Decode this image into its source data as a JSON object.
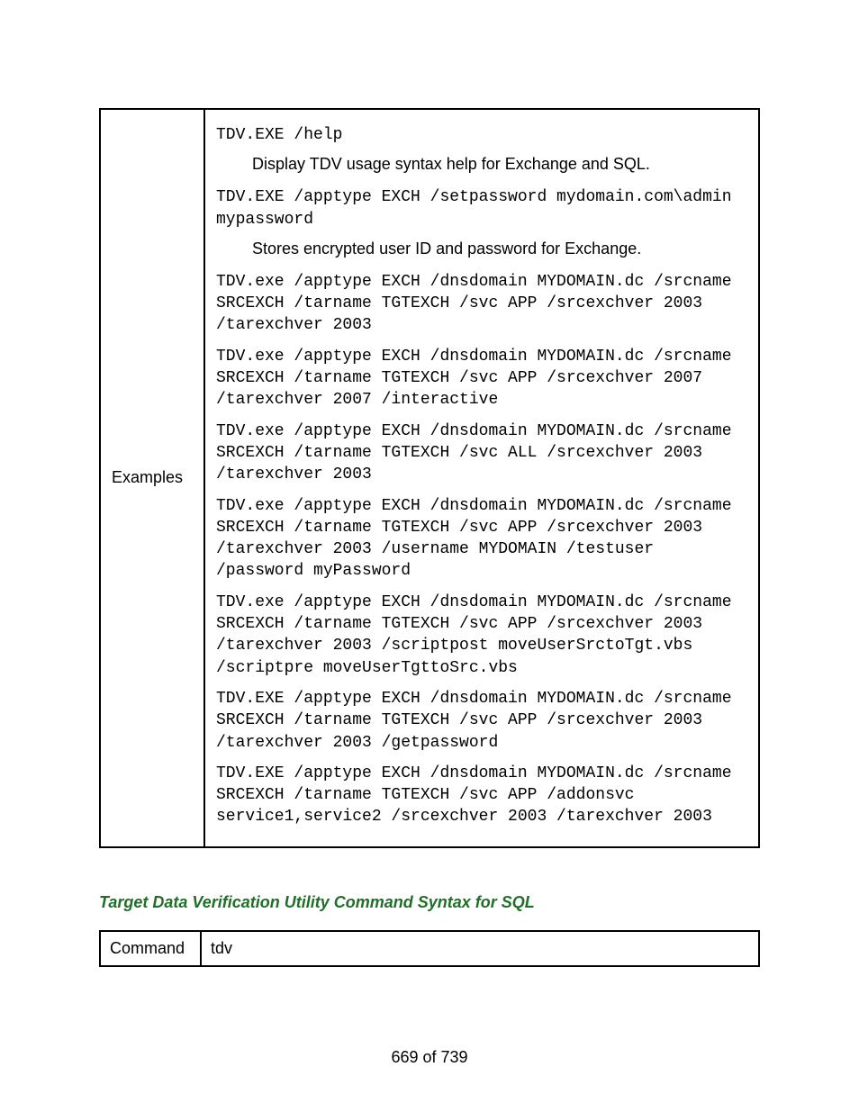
{
  "examples_label": "Examples",
  "blocks": [
    {
      "type": "mono",
      "text": "TDV.EXE /help"
    },
    {
      "type": "desc",
      "text": "Display TDV usage syntax help for Exchange and SQL."
    },
    {
      "type": "mono",
      "text": "TDV.EXE /apptype EXCH /setpassword mydomain.com\\admin mypassword"
    },
    {
      "type": "desc",
      "text": "Stores encrypted user ID and password for Exchange."
    },
    {
      "type": "mono",
      "text": "TDV.exe /apptype EXCH /dnsdomain MYDOMAIN.dc /srcname SRCEXCH /tarname TGTEXCH /svc APP /srcexchver 2003 /tarexchver 2003"
    },
    {
      "type": "mono",
      "text": "TDV.exe /apptype EXCH /dnsdomain MYDOMAIN.dc /srcname SRCEXCH /tarname TGTEXCH /svc APP /srcexchver 2007 /tarexchver 2007 /interactive"
    },
    {
      "type": "mono",
      "text": "TDV.exe /apptype EXCH /dnsdomain MYDOMAIN.dc /srcname SRCEXCH /tarname TGTEXCH /svc ALL /srcexchver 2003 /tarexchver 2003"
    },
    {
      "type": "mono",
      "text": "TDV.exe /apptype EXCH /dnsdomain MYDOMAIN.dc /srcname SRCEXCH /tarname TGTEXCH /svc APP /srcexchver 2003 /tarexchver 2003 /username MYDOMAIN /testuser /password myPassword"
    },
    {
      "type": "mono",
      "text": "TDV.exe /apptype EXCH /dnsdomain MYDOMAIN.dc /srcname SRCEXCH /tarname TGTEXCH /svc APP /srcexchver 2003 /tarexchver 2003 /scriptpost moveUserSrctoTgt.vbs /scriptpre moveUserTgttoSrc.vbs"
    },
    {
      "type": "mono",
      "text": "TDV.EXE /apptype EXCH /dnsdomain MYDOMAIN.dc /srcname SRCEXCH /tarname TGTEXCH /svc APP /srcexchver 2003 /tarexchver 2003 /getpassword"
    },
    {
      "type": "mono",
      "text": "TDV.EXE /apptype EXCH /dnsdomain MYDOMAIN.dc /srcname SRCEXCH /tarname TGTEXCH /svc APP /addonsvc service1,service2 /srcexchver 2003 /tarexchver 2003"
    }
  ],
  "section_title": "Target Data Verification Utility Command Syntax for SQL",
  "cmd_row": {
    "label": "Command",
    "value": "tdv"
  },
  "page_number": "669 of 739"
}
